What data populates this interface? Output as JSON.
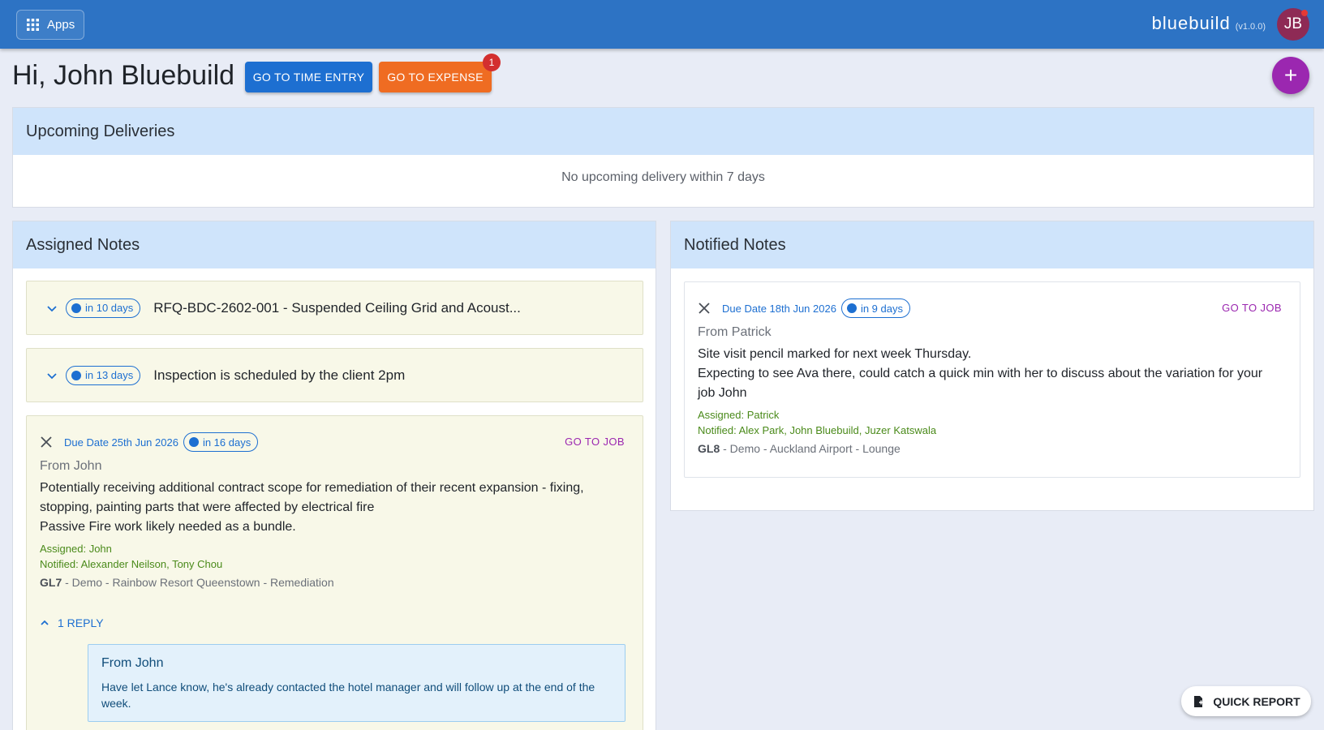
{
  "topbar": {
    "apps_label": "Apps",
    "brand": "bluebuild",
    "version": "(v1.0.0)",
    "avatar_initials": "JB"
  },
  "greeting": "Hi, John Bluebuild",
  "actions": {
    "time_entry": "GO TO TIME ENTRY",
    "expense": "GO TO EXPENSE",
    "expense_badge": "1",
    "fab": "+"
  },
  "deliveries": {
    "title": "Upcoming Deliveries",
    "empty_text": "No upcoming delivery within 7 days"
  },
  "assigned": {
    "title": "Assigned Notes",
    "collapsed": [
      {
        "pill": "in 10 days",
        "title": "RFQ-BDC-2602-001 - Suspended Ceiling Grid and Acoust..."
      },
      {
        "pill": "in 13 days",
        "title": "Inspection is scheduled by the client 2pm"
      }
    ],
    "expanded": {
      "due": "Due Date 25th Jun 2026",
      "pill": "in 16 days",
      "go_to_job": "GO TO JOB",
      "from": "From John",
      "body_line1": "Potentially receiving additional contract scope for remediation of their recent expansion - fixing, stopping, painting parts that were affected by electrical fire",
      "body_line2": "Passive Fire work likely needed as a bundle.",
      "assigned": "Assigned: John",
      "notified": "Notified: Alexander Neilson, Tony Chou",
      "job_code": "GL7",
      "job_name": " - Demo - Rainbow Resort Queenstown - Remediation",
      "reply_toggle": "1 REPLY",
      "reply": {
        "from": "From John",
        "text": "Have let Lance know, he's already contacted the hotel manager and will follow up at the end of the week."
      }
    }
  },
  "notified": {
    "title": "Notified Notes",
    "card": {
      "due": "Due Date 18th Jun 2026",
      "pill": "in 9 days",
      "go_to_job": "GO TO JOB",
      "from": "From Patrick",
      "body_line1": "Site visit pencil marked for next week Thursday.",
      "body_line2": "Expecting to see Ava there, could catch a quick min with her to discuss about the variation for your job John",
      "assigned": "Assigned: Patrick",
      "notified": "Notified: Alex Park, John Bluebuild, Juzer Katswala",
      "job_code": "GL8",
      "job_name": " - Demo - Auckland Airport - Lounge"
    }
  },
  "quick_report": "QUICK REPORT",
  "colors": {
    "topbar": "#2d73c4",
    "primary": "#1d6fd1",
    "expense": "#ef6c22",
    "accent": "#9b27b0",
    "panel_header": "#cfe4fb",
    "note_bg": "#f8f8e8"
  },
  "icons": [
    "apps-grid-icon",
    "chevron-down-icon",
    "chevron-up-icon",
    "close-icon",
    "plus-icon",
    "report-icon"
  ]
}
